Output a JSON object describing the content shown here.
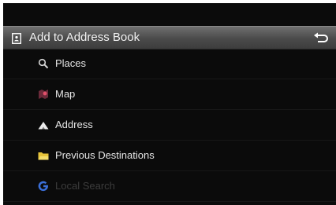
{
  "header": {
    "title": "Add to Address Book",
    "icon": "address-book-icon",
    "back_icon": "back-arrow-icon"
  },
  "menu": {
    "items": [
      {
        "label": "Places",
        "icon": "search-icon"
      },
      {
        "label": "Map",
        "icon": "map-icon"
      },
      {
        "label": "Address",
        "icon": "address-icon"
      },
      {
        "label": "Previous Destinations",
        "icon": "folder-icon"
      },
      {
        "label": "Local Search",
        "icon": "google-icon"
      }
    ]
  },
  "colors": {
    "background": "#0b0b0b",
    "header": "#555555",
    "text": "#e6e6e6",
    "google_blue": "#3b6fd8"
  }
}
